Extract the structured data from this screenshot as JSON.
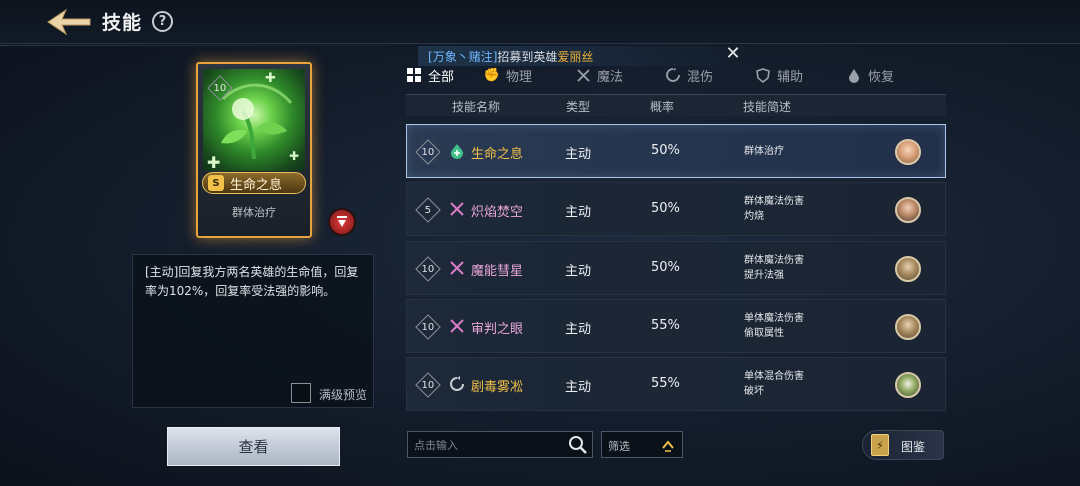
{
  "header": {
    "title": "技能",
    "help": "?"
  },
  "notice": {
    "bracket_open": "[",
    "source": "万象丶赌注",
    "bracket_close": "]",
    "text": "招募到英雄",
    "hero": "爱丽丝",
    "close": "✕"
  },
  "card": {
    "level": "10",
    "grade": "S",
    "name": "生命之息",
    "desc": "群体治疗"
  },
  "detail": {
    "text": "[主动]回复我方两名英雄的生命值，回复率为102%，回复率受法强的影响。",
    "max_preview_label": "满级预览"
  },
  "view_button": "查看",
  "tabs": [
    {
      "label": "全部",
      "icon": "grid-icon",
      "active": true
    },
    {
      "label": "物理",
      "icon": "fist-icon"
    },
    {
      "label": "魔法",
      "icon": "magic-icon"
    },
    {
      "label": "混伤",
      "icon": "swirl-icon"
    },
    {
      "label": "辅助",
      "icon": "shield-icon"
    },
    {
      "label": "恢复",
      "icon": "drop-icon"
    }
  ],
  "table": {
    "headers": [
      "技能名称",
      "类型",
      "概率",
      "技能简述"
    ],
    "rows": [
      {
        "level": "10",
        "name": "生命之息",
        "icon": "heal-icon",
        "color": "#f0c048",
        "type": "主动",
        "rate": "50%",
        "desc": [
          "群体治疗"
        ],
        "selected": true
      },
      {
        "level": "5",
        "name": "炽焰焚空",
        "icon": "magic-icon",
        "color": "#e8a6d8",
        "type": "主动",
        "rate": "50%",
        "desc": [
          "群体魔法伤害",
          "灼烧"
        ]
      },
      {
        "level": "10",
        "name": "魔能彗星",
        "icon": "magic-icon",
        "color": "#e8a6d8",
        "type": "主动",
        "rate": "50%",
        "desc": [
          "群体魔法伤害",
          "提升法强"
        ]
      },
      {
        "level": "10",
        "name": "审判之眼",
        "icon": "magic-icon",
        "color": "#e8a6d8",
        "type": "主动",
        "rate": "55%",
        "desc": [
          "单体魔法伤害",
          "偷取属性"
        ]
      },
      {
        "level": "10",
        "name": "剧毒雾凇",
        "icon": "swirl-icon",
        "color": "#f0c048",
        "type": "主动",
        "rate": "55%",
        "desc": [
          "单体混合伤害",
          "破坏"
        ]
      }
    ]
  },
  "search": {
    "placeholder": "点击输入"
  },
  "filter": {
    "label": "筛选"
  },
  "atlas": {
    "label": "图鉴"
  }
}
